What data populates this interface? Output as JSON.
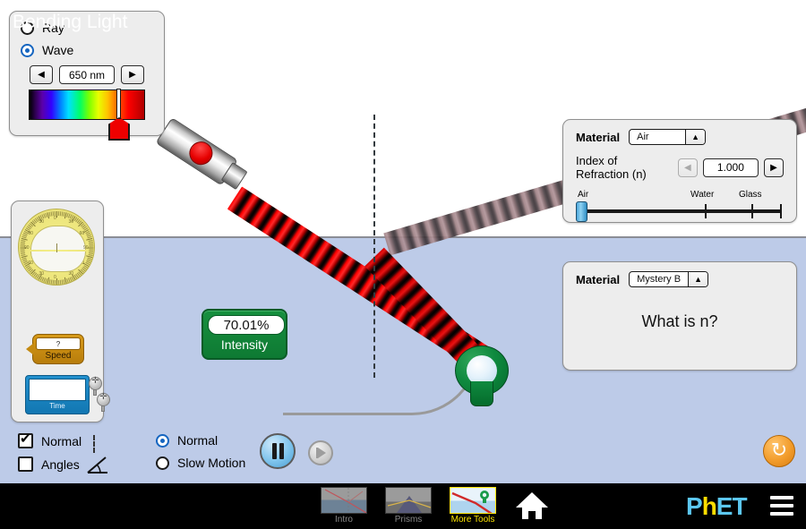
{
  "sim": {
    "title": "Bending Light",
    "tab_active": "More Tools"
  },
  "laser_type_panel": {
    "options": [
      {
        "label": "Ray",
        "selected": false
      },
      {
        "label": "Wave",
        "selected": true
      }
    ],
    "wavelength": {
      "value": "650 nm",
      "left_arrow": "◀",
      "right_arrow": "▶"
    }
  },
  "toolbox": {
    "protractor_name": "protractor",
    "speed_tool": {
      "readout": "?",
      "label": "Speed"
    },
    "time_tool": {
      "label": "Time"
    }
  },
  "intensity_meter": {
    "value": "70.01%",
    "label": "Intensity"
  },
  "material_top": {
    "material_label": "Material",
    "material_value": "Air",
    "combo_arrow": "▲",
    "ior_label": "Index of Refraction (n)",
    "ior_value": "1.000",
    "left_arrow": "◀",
    "right_arrow": "▶",
    "ticks": [
      {
        "label": "Air",
        "pos": 0
      },
      {
        "label": "Water",
        "pos": 145
      },
      {
        "label": "Glass",
        "pos": 196
      }
    ]
  },
  "material_bottom": {
    "material_label": "Material",
    "material_value": "Mystery B",
    "combo_arrow": "▲",
    "question": "What is n?"
  },
  "view_controls": {
    "checkboxes": [
      {
        "label": "Normal",
        "checked": true
      },
      {
        "label": "Angles",
        "checked": false
      }
    ]
  },
  "speed_controls": {
    "options": [
      {
        "label": "Normal",
        "selected": true
      },
      {
        "label": "Slow Motion",
        "selected": false
      }
    ],
    "pause_name": "pause-button",
    "step_name": "step-forward-button"
  },
  "reset": {
    "glyph": "↻",
    "name": "reset-all-button"
  },
  "navbar": {
    "tabs": [
      {
        "label": "Intro",
        "active": false
      },
      {
        "label": "Prisms",
        "active": false
      },
      {
        "label": "More Tools",
        "active": true
      }
    ],
    "home_label": "Home",
    "logo_p": "P",
    "logo_h": "h",
    "logo_et": "ET",
    "menu_label": "Menu"
  },
  "colors": {
    "accent_blue": "#1565c0",
    "water": "#bdcbe8",
    "air": "#ffffff",
    "laser_red": "#ee0000",
    "intensity_green": "#0e7a33",
    "reset_orange": "#f29c2b",
    "active_tab_yellow": "#ffe600",
    "phet_blue": "#5cc7f0",
    "phet_yellow": "#ffdd00"
  }
}
